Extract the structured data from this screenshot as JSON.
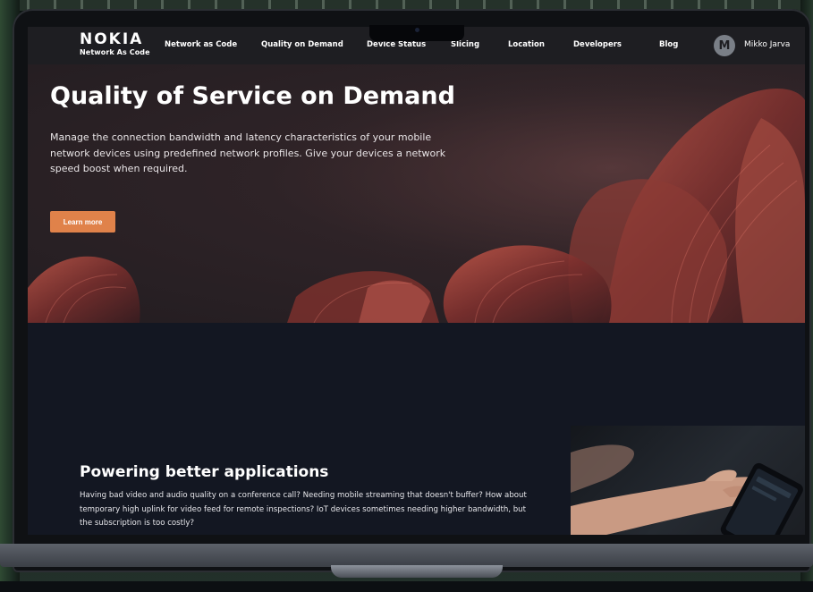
{
  "brand": {
    "logo": "NOKIA",
    "subtitle": "Network As Code"
  },
  "nav": {
    "items": [
      {
        "label": "Network as Code"
      },
      {
        "label": "Quality on Demand"
      },
      {
        "label": "Device Status"
      },
      {
        "label": "Slicing"
      },
      {
        "label": "Location"
      },
      {
        "label": "Developers"
      },
      {
        "label": "Blog"
      }
    ],
    "user": {
      "initial": "M",
      "name": "Mikko Jarva"
    }
  },
  "hero": {
    "title": "Quality of Service on Demand",
    "description": "Manage the connection bandwidth and latency characteristics of your mobile network devices using predefined network profiles. Give your devices a network speed boost when required.",
    "cta": "Learn more"
  },
  "section": {
    "title": "Powering better applications",
    "text": "Having bad video and audio quality on a conference call? Needing mobile streaming that doesn't buffer? How about temporary high uplink for video feed for remote inspections? IoT devices sometimes needing higher bandwidth, but the subscription is too costly?"
  },
  "colors": {
    "accent": "#e0824a",
    "nav_bg": "#1e1e22",
    "hero_bg": "#2b2024",
    "section_bg": "#131722"
  }
}
